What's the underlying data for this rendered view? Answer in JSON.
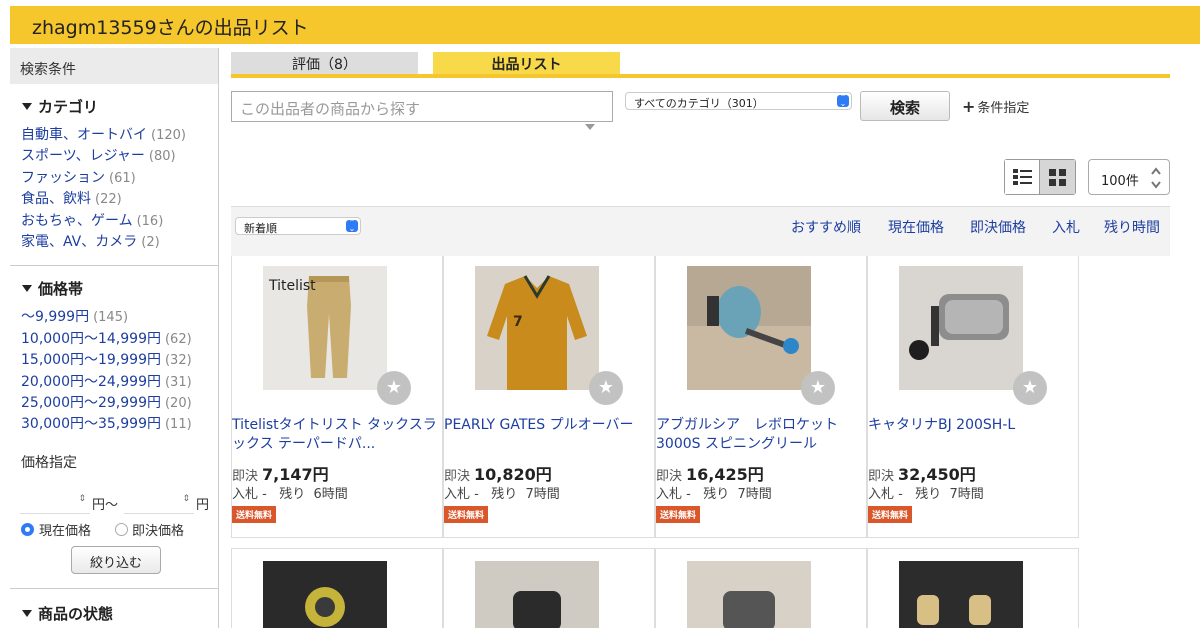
{
  "header": {
    "title": "zhagm13559さんの出品リスト"
  },
  "sidebar": {
    "search_conditions": "検索条件",
    "category": {
      "title": "カテゴリ",
      "items": [
        {
          "label": "自動車、オートバイ",
          "count": "(120)"
        },
        {
          "label": "スポーツ、レジャー",
          "count": "(80)"
        },
        {
          "label": "ファッション",
          "count": "(61)"
        },
        {
          "label": "食品、飲料",
          "count": "(22)"
        },
        {
          "label": "おもちゃ、ゲーム",
          "count": "(16)"
        },
        {
          "label": "家電、AV、カメラ",
          "count": "(2)"
        }
      ]
    },
    "price_range": {
      "title": "価格帯",
      "items": [
        {
          "label": "〜9,999円",
          "count": "(145)"
        },
        {
          "label": "10,000円〜14,999円",
          "count": "(62)"
        },
        {
          "label": "15,000円〜19,999円",
          "count": "(32)"
        },
        {
          "label": "20,000円〜24,999円",
          "count": "(31)"
        },
        {
          "label": "25,000円〜29,999円",
          "count": "(20)"
        },
        {
          "label": "30,000円〜35,999円",
          "count": "(11)"
        }
      ]
    },
    "price_spec": {
      "title": "価格指定",
      "unit_from": "円〜",
      "unit_to": "円",
      "radio_current": "現在価格",
      "radio_buynow": "即決価格",
      "filter_button": "絞り込む"
    },
    "condition": {
      "title": "商品の状態"
    }
  },
  "tabs": [
    {
      "label": "評価（8）"
    },
    {
      "label": "出品リスト"
    }
  ],
  "search": {
    "placeholder": "この出品者の商品から探す",
    "category_select": "すべてのカテゴリ（301）",
    "button": "検索",
    "conditions_link": "条件指定"
  },
  "per_page": "100件",
  "sort": {
    "select": "新着順",
    "links": [
      "おすすめ順",
      "現在価格",
      "即決価格",
      "入札",
      "残り時間"
    ]
  },
  "items": [
    {
      "title": "Titelistタイトリスト タックスラックス テーパードパ...",
      "price_label": "即決",
      "price": "7,147円",
      "bids": "入札 -",
      "remaining_label": "残り",
      "remaining": "6時間",
      "badge": "送料無料",
      "thumb_text": "Titelist"
    },
    {
      "title": "PEARLY GATES プルオーバー",
      "price_label": "即決",
      "price": "10,820円",
      "bids": "入札 -",
      "remaining_label": "残り",
      "remaining": "7時間",
      "badge": "送料無料"
    },
    {
      "title": "アブガルシア　レボロケット3000S スピニングリール",
      "price_label": "即決",
      "price": "16,425円",
      "bids": "入札 -",
      "remaining_label": "残り",
      "remaining": "7時間",
      "badge": "送料無料"
    },
    {
      "title": "キャタリナBJ 200SH-L",
      "price_label": "即決",
      "price": "32,450円",
      "bids": "入札 -",
      "remaining_label": "残り",
      "remaining": "7時間",
      "badge": "送料無料"
    }
  ],
  "colors": {
    "brand_yellow": "#f5c72c",
    "link_blue": "#1d3ea0",
    "badge_orange": "#d9572b"
  }
}
